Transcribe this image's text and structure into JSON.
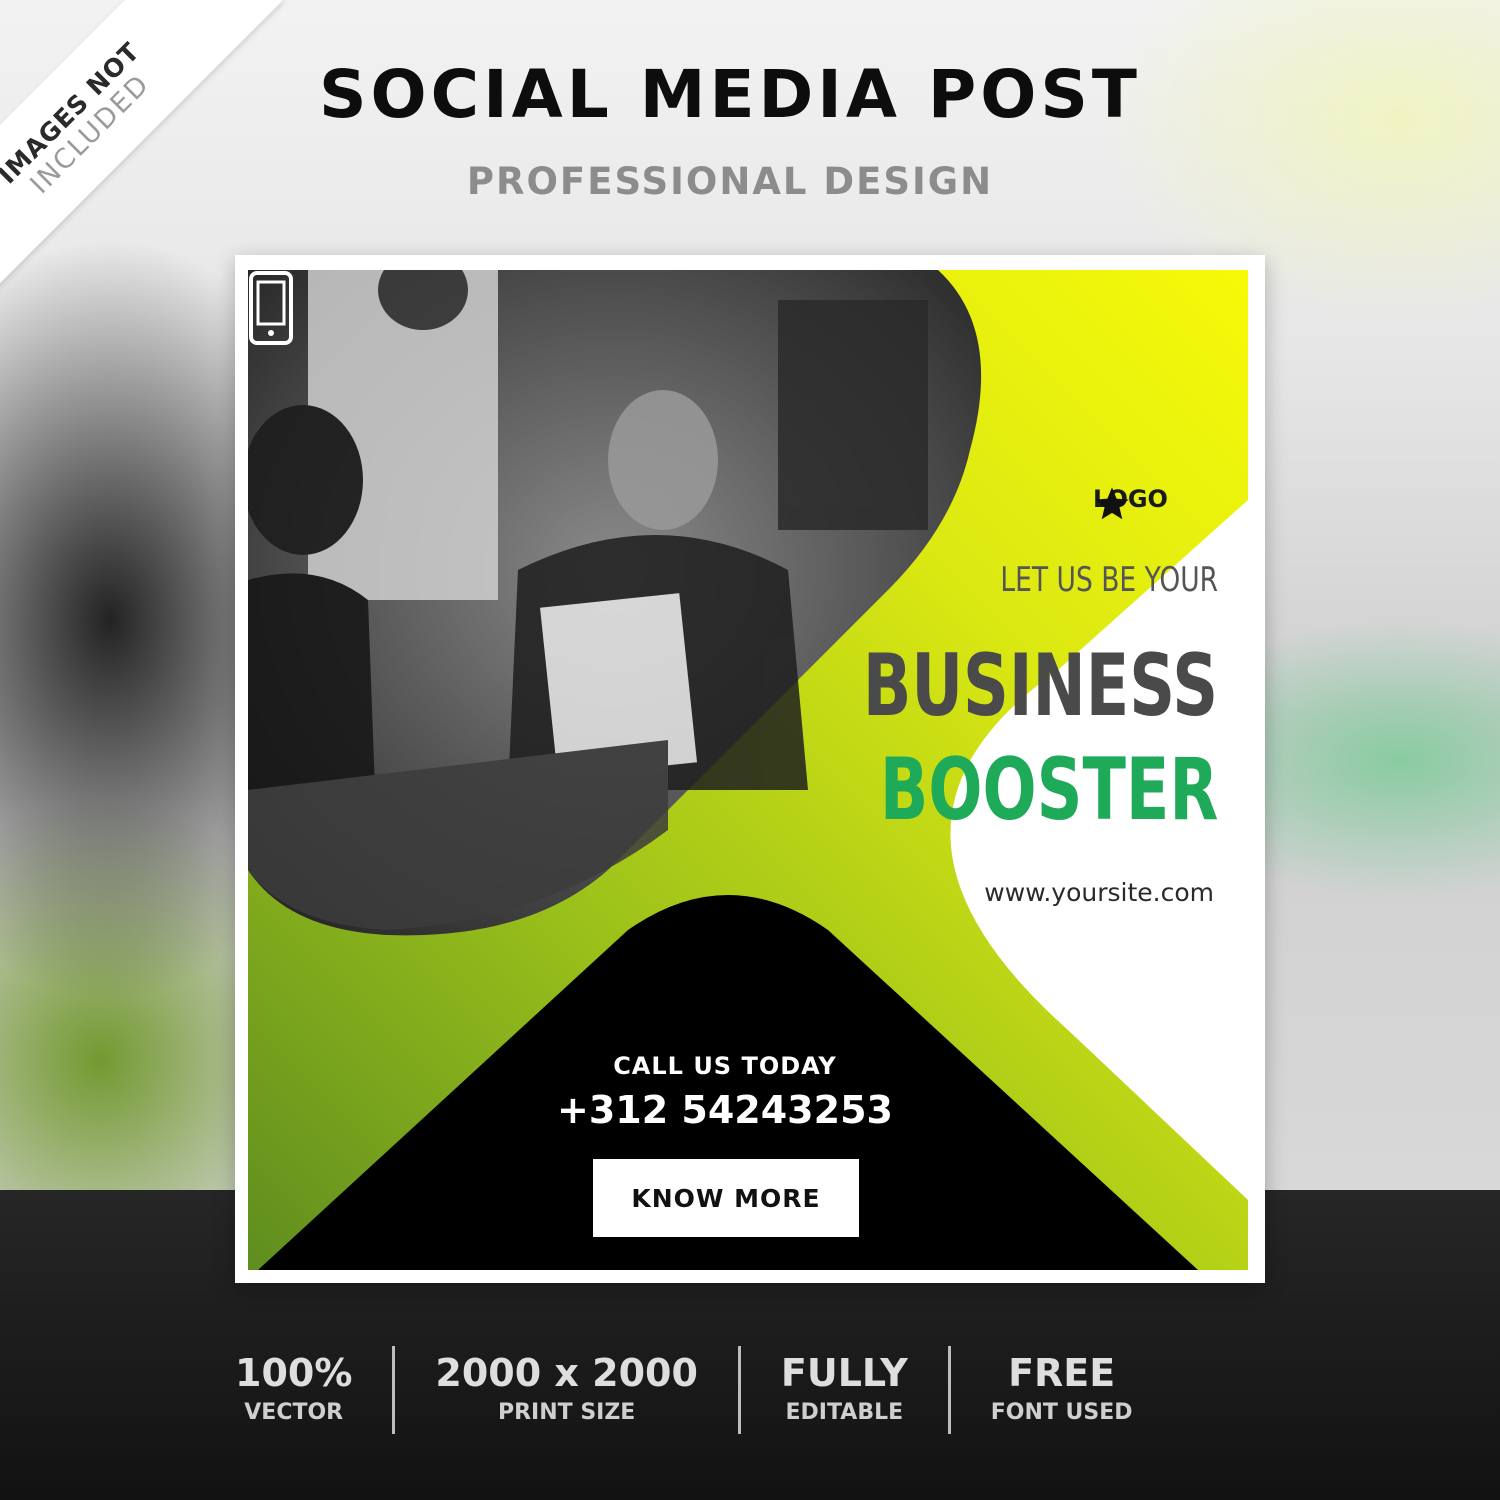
{
  "ribbon": {
    "line1": "IMAGES NOT",
    "line2": "INCLUDED"
  },
  "header": {
    "title": "SOCIAL MEDIA POST",
    "subtitle": "PROFESSIONAL DESIGN"
  },
  "post": {
    "logo_icon": "star-icon",
    "logo_text": "LOGO",
    "tagline": "LET US BE YOUR",
    "headline_line1": "BUSINESS",
    "headline_line2": "BOOSTER",
    "website": "www.yoursite.com",
    "phone_icon": "smartphone-icon",
    "call_label": "CALL US TODAY",
    "phone_number": "+312 54243253",
    "button_label": "KNOW MORE",
    "colors": {
      "lime": "#f4f80a",
      "green": "#6b9a1e",
      "accent_green": "#1faa59",
      "black": "#000000",
      "headline_gray": "#4a4a4a"
    }
  },
  "features": [
    {
      "main": "100%",
      "sub": "VECTOR"
    },
    {
      "main": "2000 x 2000",
      "sub": "PRINT SIZE"
    },
    {
      "main": "FULLY",
      "sub": "EDITABLE"
    },
    {
      "main": "FREE",
      "sub": "FONT USED"
    }
  ]
}
